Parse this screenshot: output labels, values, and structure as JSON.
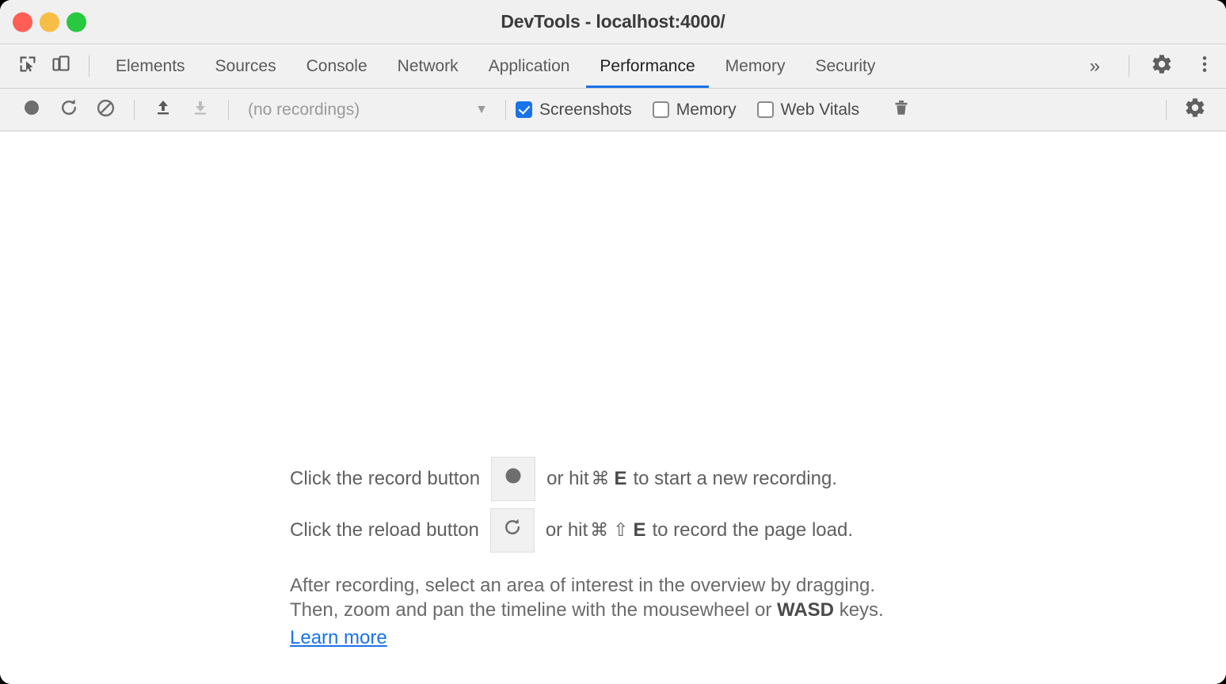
{
  "window": {
    "title": "DevTools - localhost:4000/",
    "traffic_lights": [
      {
        "name": "close",
        "color": "#ff5f57"
      },
      {
        "name": "minimize",
        "color": "#f7bd46"
      },
      {
        "name": "maximize",
        "color": "#28c840"
      }
    ]
  },
  "tabbar": {
    "inspect_icon": "inspect-element-icon",
    "device_icon": "device-toolbar-icon",
    "tabs": [
      {
        "label": "Elements",
        "active": false
      },
      {
        "label": "Sources",
        "active": false
      },
      {
        "label": "Console",
        "active": false
      },
      {
        "label": "Network",
        "active": false
      },
      {
        "label": "Application",
        "active": false
      },
      {
        "label": "Performance",
        "active": true
      },
      {
        "label": "Memory",
        "active": false
      },
      {
        "label": "Security",
        "active": false
      }
    ],
    "more_tabs_label": "»",
    "settings_icon": "gear-icon",
    "menu_icon": "more-vertical-icon",
    "active_accent_color": "#1a73e8"
  },
  "toolbar": {
    "record_icon": "record-icon",
    "reload_icon": "reload-record-icon",
    "clear_icon": "clear-icon",
    "load_icon": "load-profile-icon",
    "save_icon": "save-profile-icon",
    "recordings_value": "(no recordings)",
    "recordings_caret": "▼",
    "checkboxes": [
      {
        "label": "Screenshots",
        "checked": true
      },
      {
        "label": "Memory",
        "checked": false
      },
      {
        "label": "Web Vitals",
        "checked": false
      }
    ],
    "trash_icon": "trash-icon",
    "settings_icon": "capture-settings-gear-icon",
    "checked_color": "#1a73e8"
  },
  "landing": {
    "record_row": {
      "prefix": "Click the record button",
      "mid": "or hit",
      "cmd": "⌘",
      "key": "E",
      "suffix": "to start a new recording."
    },
    "reload_row": {
      "prefix": "Click the reload button",
      "mid": "or hit",
      "cmd": "⌘",
      "shift": "⇧",
      "key": "E",
      "suffix": "to record the page load."
    },
    "paragraph_line1": "After recording, select an area of interest in the overview by dragging.",
    "paragraph_line2_a": "Then, zoom and pan the timeline with the mousewheel or",
    "paragraph_line2_bold": "WASD",
    "paragraph_line2_b": "keys.",
    "learn_more": "Learn more",
    "link_color": "#1a73e8"
  }
}
